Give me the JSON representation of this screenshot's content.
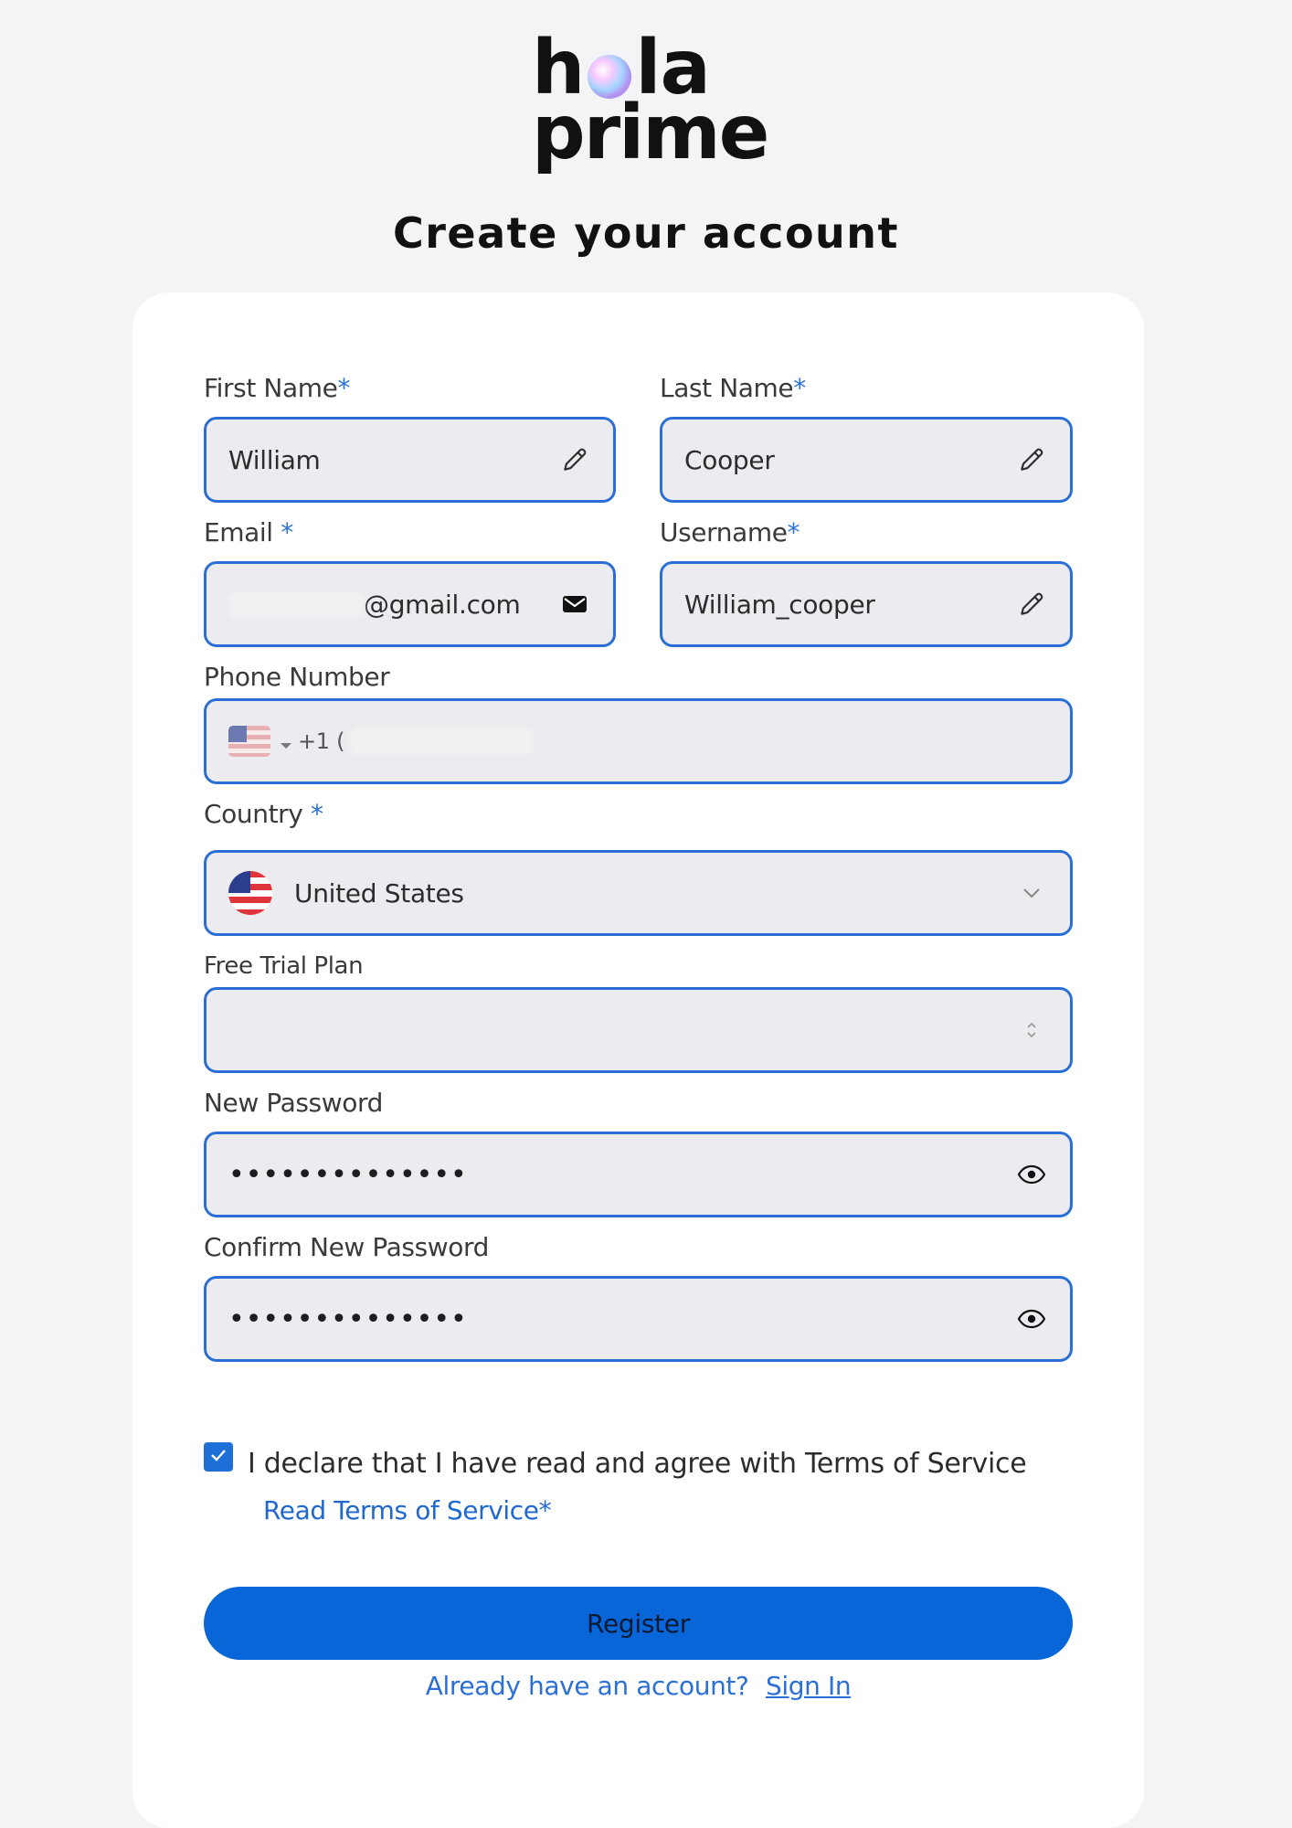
{
  "brand": {
    "logo_line1_left": "h",
    "logo_line1_right": "la",
    "logo_line2": "prime"
  },
  "heading": "Create your account",
  "form": {
    "first_name": {
      "label": "First Name",
      "required": "*",
      "value": "William",
      "icon": "pencil-icon"
    },
    "last_name": {
      "label": "Last Name",
      "required": "*",
      "value": "Cooper",
      "icon": "pencil-icon"
    },
    "email": {
      "label": "Email ",
      "required": "*",
      "value": "@gmail.com",
      "icon": "envelope-icon"
    },
    "username": {
      "label": "Username",
      "required": "*",
      "value": "William_cooper",
      "icon": "pencil-icon"
    },
    "phone": {
      "label": "Phone Number",
      "dial_code": "+1 (",
      "flag": "us-flag-icon"
    },
    "country": {
      "label": "Country ",
      "required": "*",
      "value": "United States",
      "flag": "us-flag-circle-icon"
    },
    "trial_plan": {
      "label": "Free Trial Plan",
      "value": ""
    },
    "new_password": {
      "label": "New Password",
      "value": "••••••••••••••"
    },
    "confirm_password": {
      "label": "Confirm New Password",
      "value": "••••••••••••••"
    }
  },
  "terms": {
    "checked": true,
    "text": "I declare that I have read and agree with Terms of Service",
    "link": "Read Terms of Service*"
  },
  "register_label": "Register",
  "signin": {
    "prompt": "Already have an account?",
    "link": "Sign In"
  },
  "colors": {
    "accent": "#0866d9",
    "field_border": "#2b6fd6",
    "field_bg": "#ececf0",
    "page_bg": "#f4f4f6"
  }
}
